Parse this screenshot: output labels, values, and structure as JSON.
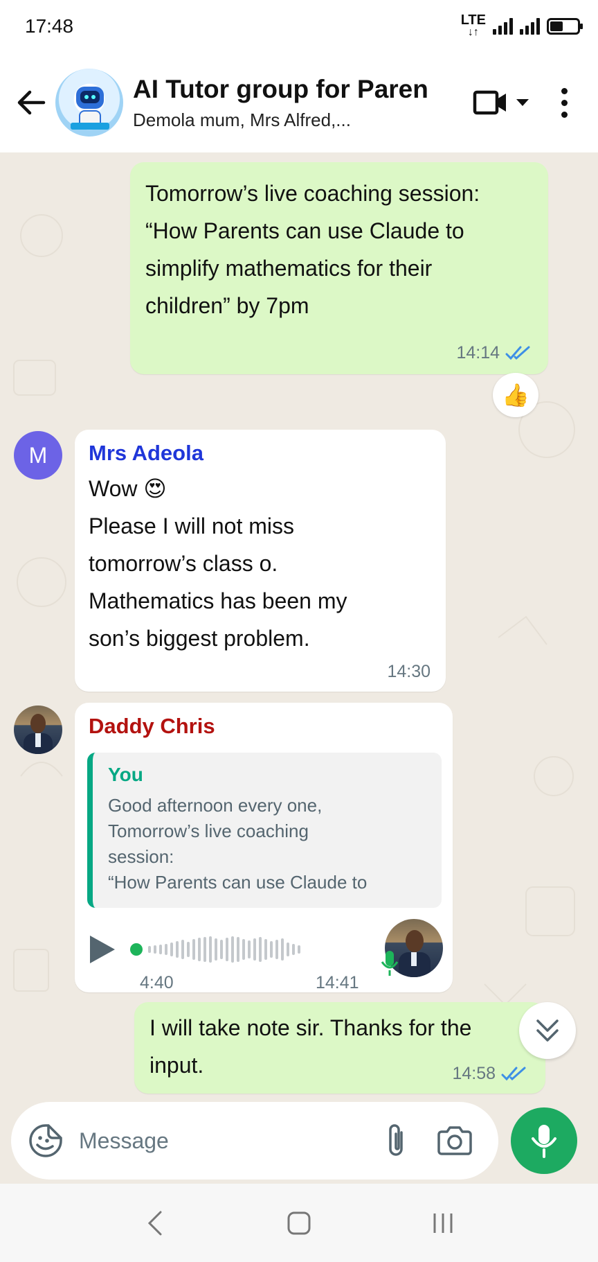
{
  "status_bar": {
    "time": "17:48",
    "network": "LTE",
    "icons": [
      "lte-icon",
      "signal-icon",
      "signal-icon",
      "battery-icon"
    ]
  },
  "header": {
    "title": "AI Tutor group for Paren",
    "subtitle": "Demola mum, Mrs Alfred,..."
  },
  "messages": [
    {
      "direction": "out",
      "text_lines": [
        "Tomorrow’s live coaching session:",
        "“How Parents can use Claude to",
        "simplify mathematics for their",
        "children” by 7pm"
      ],
      "time": "14:14",
      "reaction": "👍"
    },
    {
      "direction": "in",
      "avatar_letter": "M",
      "sender": "Mrs Adeola",
      "sender_color": "#1f36d9",
      "text_lines": [
        "Wow 😍",
        "Please I will not miss",
        "tomorrow’s class o.",
        "Mathematics has been my",
        "son’s biggest problem."
      ],
      "time": "14:30"
    },
    {
      "direction": "in",
      "sender": "Daddy Chris",
      "sender_color": "#b3120f",
      "quote": {
        "author": "You",
        "lines": [
          "Good afternoon every one,",
          "Tomorrow’s live coaching",
          "session:",
          "“How Parents can use Claude to"
        ]
      },
      "voice_duration": "4:40",
      "time": "14:41"
    },
    {
      "direction": "out",
      "text_lines": [
        "I will take note sir. Thanks for the",
        "input."
      ],
      "time": "14:58"
    }
  ],
  "composer": {
    "placeholder": "Message"
  },
  "colors": {
    "outgoing_bubble": "#dcf8c6",
    "incoming_bubble": "#ffffff",
    "accent_green": "#1daa61",
    "read_tick": "#3d8fe6"
  }
}
